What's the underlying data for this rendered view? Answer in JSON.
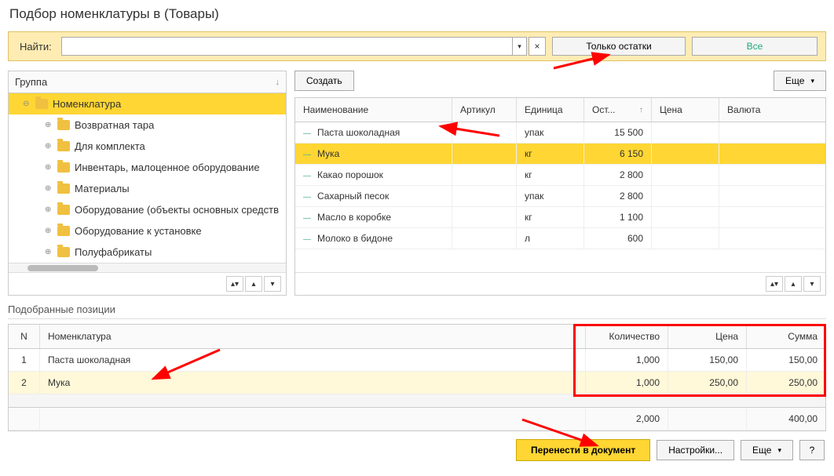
{
  "window_title": "Подбор номенклатуры в  (Товары)",
  "search": {
    "label": "Найти:",
    "value": ""
  },
  "filters": {
    "stock_only": "Только остатки",
    "all": "Все"
  },
  "tree": {
    "header": "Группа",
    "root": "Номенклатура",
    "children": [
      "Возвратная тара",
      "Для комплекта",
      "Инвентарь, малоценное оборудование",
      "Материалы",
      "Оборудование (объекты основных средств",
      "Оборудование к установке",
      "Полуфабрикаты"
    ]
  },
  "toolbar": {
    "create": "Создать",
    "more": "Еще"
  },
  "grid": {
    "headers": {
      "name": "Наименование",
      "art": "Артикул",
      "unit": "Единица",
      "stock": "Ост...",
      "price": "Цена",
      "curr": "Валюта"
    },
    "rows": [
      {
        "name": "Паста шоколадная",
        "art": "",
        "unit": "упак",
        "stock": "15 500",
        "price": "",
        "curr": ""
      },
      {
        "name": "Мука",
        "art": "",
        "unit": "кг",
        "stock": "6 150",
        "price": "",
        "curr": ""
      },
      {
        "name": "Какао порошок",
        "art": "",
        "unit": "кг",
        "stock": "2 800",
        "price": "",
        "curr": ""
      },
      {
        "name": "Сахарный песок",
        "art": "",
        "unit": "упак",
        "stock": "2 800",
        "price": "",
        "curr": ""
      },
      {
        "name": "Масло в коробке",
        "art": "",
        "unit": "кг",
        "stock": "1 100",
        "price": "",
        "curr": ""
      },
      {
        "name": "Молоко в бидоне",
        "art": "",
        "unit": "л",
        "stock": "600",
        "price": "",
        "curr": ""
      }
    ],
    "selected_index": 1
  },
  "picked": {
    "title": "Подобранные позиции",
    "headers": {
      "n": "N",
      "name": "Номенклатура",
      "qty": "Количество",
      "price": "Цена",
      "sum": "Сумма"
    },
    "rows": [
      {
        "n": "1",
        "name": "Паста шоколадная",
        "qty": "1,000",
        "price": "150,00",
        "sum": "150,00"
      },
      {
        "n": "2",
        "name": "Мука",
        "qty": "1,000",
        "price": "250,00",
        "sum": "250,00"
      }
    ],
    "totals": {
      "qty": "2,000",
      "sum": "400,00"
    }
  },
  "footer": {
    "transfer": "Перенести в документ",
    "settings": "Настройки...",
    "more": "Еще",
    "help": "?"
  }
}
